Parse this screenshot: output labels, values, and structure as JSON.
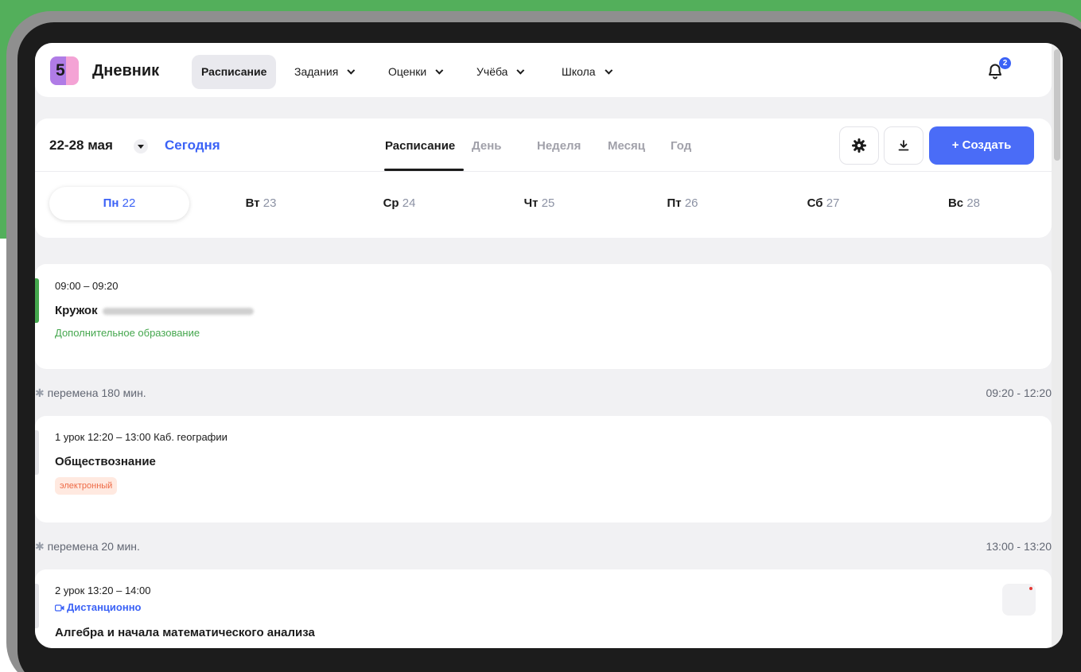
{
  "app": {
    "logo_text": "5",
    "brand": "Дневник",
    "nav": [
      {
        "label": "Расписание"
      },
      {
        "label": "Задания"
      },
      {
        "label": "Оценки"
      },
      {
        "label": "Учёба"
      },
      {
        "label": "Школа"
      }
    ],
    "notifications_count": "2"
  },
  "calendar": {
    "range": "22-28 мая",
    "today": "Сегодня",
    "views": [
      {
        "label": "Расписание",
        "active": true
      },
      {
        "label": "День"
      },
      {
        "label": "Неделя"
      },
      {
        "label": "Месяц"
      },
      {
        "label": "Год"
      }
    ],
    "create_label": "+ Создать",
    "days": [
      {
        "name": "Пн",
        "num": "22",
        "active": true
      },
      {
        "name": "Вт",
        "num": "23"
      },
      {
        "name": "Ср",
        "num": "24"
      },
      {
        "name": "Чт",
        "num": "25"
      },
      {
        "name": "Пт",
        "num": "26"
      },
      {
        "name": "Сб",
        "num": "27"
      },
      {
        "name": "Вс",
        "num": "28"
      }
    ]
  },
  "schedule": {
    "club": {
      "time": "09:00 – 09:20",
      "title": "Кружок",
      "subtitle": "Дополнительное образование"
    },
    "break1": {
      "label": "перемена 180 мин.",
      "time": "09:20 - 12:20"
    },
    "lesson1": {
      "time": "1 урок 12:20 – 13:00 Каб. географии",
      "title": "Обществознание",
      "tag": "электронный"
    },
    "break2": {
      "label": "перемена 20 мин.",
      "time": "13:00 - 13:20"
    },
    "lesson2": {
      "time": "2 урок 13:20 – 14:00",
      "remote": "Дистанционно",
      "title": "Алгебра и начала математического анализа"
    }
  },
  "colors": {
    "accent": "#4a6cf7",
    "green": "#45a74e",
    "tag_bg": "#ffe9e0",
    "tag_fg": "#ee6a45",
    "frame_green": "#53af5b"
  }
}
